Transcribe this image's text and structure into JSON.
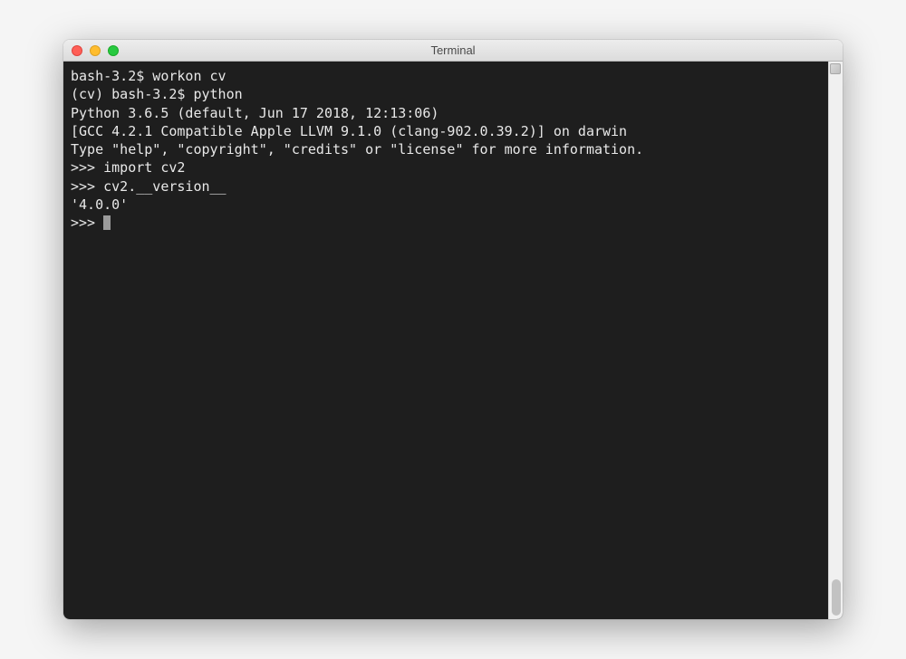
{
  "window": {
    "title": "Terminal"
  },
  "terminal": {
    "lines": [
      "bash-3.2$ workon cv",
      "(cv) bash-3.2$ python",
      "Python 3.6.5 (default, Jun 17 2018, 12:13:06)",
      "[GCC 4.2.1 Compatible Apple LLVM 9.1.0 (clang-902.0.39.2)] on darwin",
      "Type \"help\", \"copyright\", \"credits\" or \"license\" for more information.",
      ">>> import cv2",
      ">>> cv2.__version__",
      "'4.0.0'"
    ],
    "prompt": ">>> "
  }
}
